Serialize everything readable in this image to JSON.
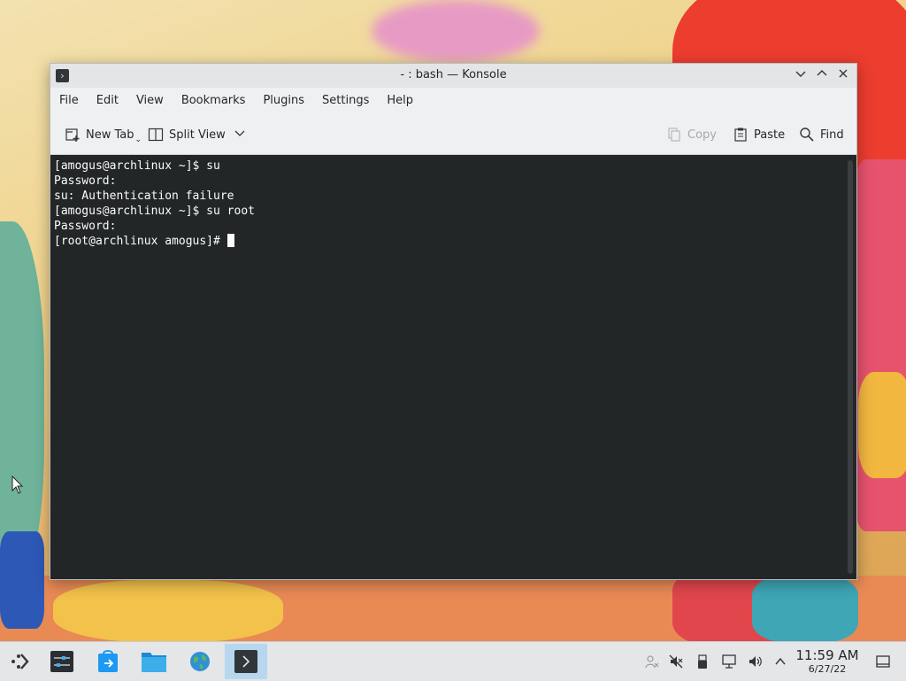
{
  "window": {
    "title": "- : bash — Konsole"
  },
  "menubar": {
    "items": [
      "File",
      "Edit",
      "View",
      "Bookmarks",
      "Plugins",
      "Settings",
      "Help"
    ]
  },
  "toolbar": {
    "new_tab_label": "New Tab",
    "split_view_label": "Split View",
    "copy_label": "Copy",
    "paste_label": "Paste",
    "find_label": "Find"
  },
  "terminal": {
    "lines": [
      "[amogus@archlinux ~]$ su",
      "Password:",
      "su: Authentication failure",
      "[amogus@archlinux ~]$ su root",
      "Password:"
    ],
    "prompt": "[root@archlinux amogus]# "
  },
  "taskbar": {
    "time": "11:59 AM",
    "date": "6/27/22",
    "apps": [
      "launcher-icon",
      "system-settings-icon",
      "discover-icon",
      "dolphin-icon",
      "browser-icon",
      "konsole-icon"
    ],
    "tray": [
      "user-icon",
      "mute-icon",
      "usb-icon",
      "network-icon",
      "volume-icon",
      "expand-tray-icon",
      "show-desktop-icon"
    ],
    "active_app": "konsole-icon"
  },
  "colors": {
    "terminal_bg": "#232627",
    "terminal_fg": "#fcfcfc",
    "taskbar_active": "#b7d7ee"
  }
}
